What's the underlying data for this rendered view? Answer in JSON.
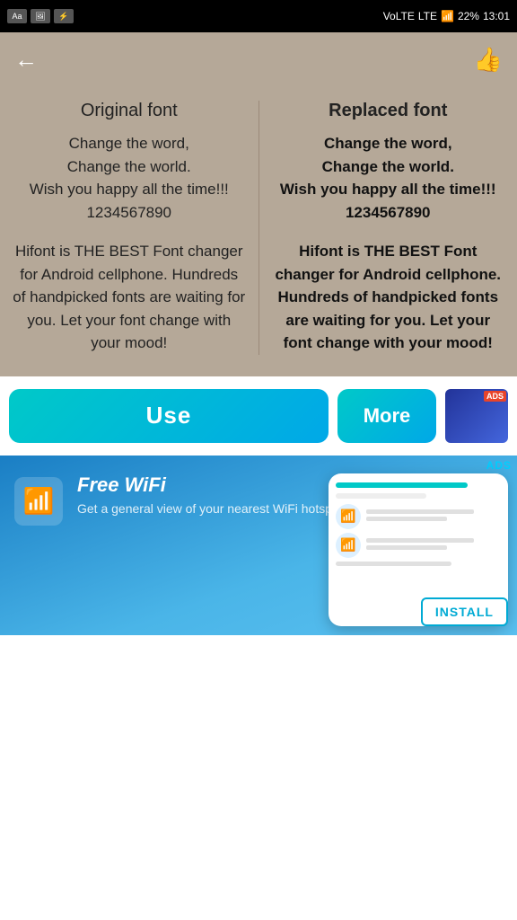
{
  "statusBar": {
    "leftIcons": [
      "Aa",
      "img",
      "usb"
    ],
    "signal": "VoLTE",
    "lte": "1",
    "battery": "22%",
    "time": "13:01"
  },
  "topBar": {
    "backLabel": "←",
    "likeLabel": "👍"
  },
  "fontPreview": {
    "originalHeader": "Original font",
    "replacedHeader": "Replaced font",
    "sampleText1": "Change the word,\nChange the world.\nWish you happy all the time!!!\n1234567890",
    "sampleText2": "Hifont is THE BEST Font changer for Android cellphone. Hundreds of handpicked fonts are waiting for you. Let your font change with your mood!"
  },
  "actions": {
    "useLabel": "Use",
    "moreLabel": "More",
    "adsLabel": "ADS"
  },
  "adBanner": {
    "adsLabel": "ADS",
    "title": "Free WiFi",
    "subtitle": "Get a general view of your nearest WiFi hotspots",
    "installLabel": "INSTALL"
  }
}
